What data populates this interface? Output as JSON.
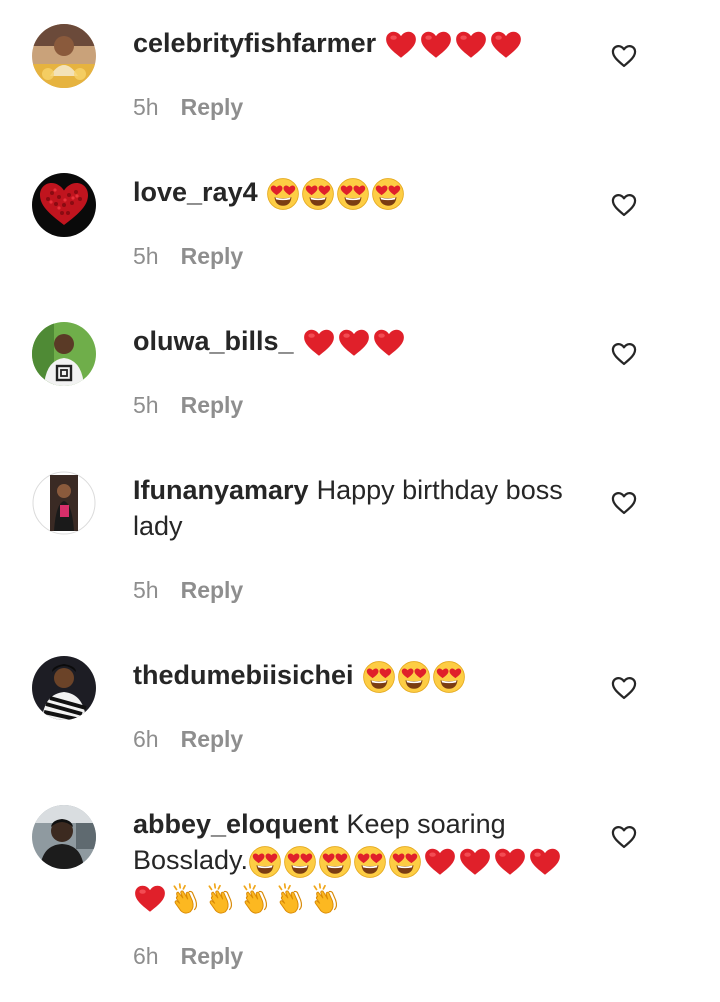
{
  "colors": {
    "text": "#262626",
    "secondary": "#8e8e8e",
    "heart_red": "#e0202a",
    "emoji_yellow": "#fdcd44"
  },
  "comments": [
    {
      "username": "celebrityfishfarmer",
      "text": "",
      "emojis": [
        "red-heart",
        "red-heart",
        "red-heart",
        "red-heart"
      ],
      "time": "5h",
      "reply_label": "Reply",
      "avatar": "person-avatar-warm"
    },
    {
      "username": "love_ray4",
      "text": "",
      "emojis": [
        "heart-eyes",
        "heart-eyes",
        "heart-eyes",
        "heart-eyes"
      ],
      "time": "5h",
      "reply_label": "Reply",
      "avatar": "red-roses-heart-avatar"
    },
    {
      "username": "oluwa_bills_",
      "text": "",
      "emojis": [
        "red-heart",
        "red-heart",
        "red-heart"
      ],
      "time": "5h",
      "reply_label": "Reply",
      "avatar": "person-avatar-green"
    },
    {
      "username": "Ifunanyamary",
      "text": "Happy birthday boss lady",
      "emojis": [],
      "time": "5h",
      "reply_label": "Reply",
      "avatar": "person-avatar-portrait"
    },
    {
      "username": "thedumebiisichei",
      "text": "",
      "emojis": [
        "heart-eyes",
        "heart-eyes",
        "heart-eyes"
      ],
      "time": "6h",
      "reply_label": "Reply",
      "avatar": "person-avatar-dark"
    },
    {
      "username": "abbey_eloquent",
      "text": "Keep soaring Bosslady.",
      "emojis": [
        "heart-eyes",
        "heart-eyes",
        "heart-eyes",
        "heart-eyes",
        "heart-eyes",
        "red-heart",
        "red-heart",
        "red-heart",
        "red-heart",
        "red-heart",
        "clapping-hands",
        "clapping-hands",
        "clapping-hands",
        "clapping-hands",
        "clapping-hands"
      ],
      "time": "6h",
      "reply_label": "Reply",
      "avatar": "person-avatar-grey"
    }
  ]
}
